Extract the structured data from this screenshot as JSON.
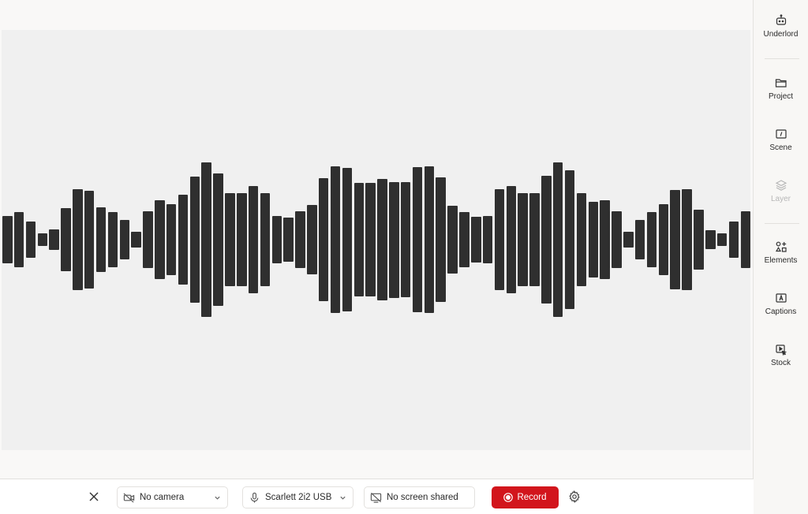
{
  "sidebar": {
    "items": [
      {
        "label": "Underlord",
        "icon": "robot-icon",
        "disabled": false
      },
      {
        "label": "Project",
        "icon": "folder-icon",
        "disabled": false
      },
      {
        "label": "Scene",
        "icon": "scene-icon",
        "disabled": false
      },
      {
        "label": "Layer",
        "icon": "layers-icon",
        "disabled": true
      },
      {
        "label": "Elements",
        "icon": "elements-icon",
        "disabled": false
      },
      {
        "label": "Captions",
        "icon": "captions-icon",
        "disabled": false
      },
      {
        "label": "Stock",
        "icon": "stock-icon",
        "disabled": false
      }
    ]
  },
  "waveform": {
    "icon": "audio-waveform",
    "bar_color": "#2f2f2f",
    "levels": [
      0.31,
      0.36,
      0.23,
      0.08,
      0.13,
      0.41,
      0.65,
      0.63,
      0.42,
      0.36,
      0.26,
      0.1,
      0.37,
      0.51,
      0.46,
      0.58,
      0.82,
      1.0,
      0.86,
      0.6,
      0.6,
      0.69,
      0.6,
      0.31,
      0.29,
      0.37,
      0.45,
      0.8,
      0.95,
      0.93,
      0.73,
      0.73,
      0.79,
      0.75,
      0.74,
      0.94,
      0.95,
      0.81,
      0.44,
      0.36,
      0.3,
      0.31,
      0.65,
      0.69,
      0.6,
      0.6,
      0.83,
      1.0,
      0.9,
      0.6,
      0.49,
      0.51,
      0.37,
      0.1,
      0.26,
      0.36,
      0.46,
      0.64,
      0.65,
      0.39,
      0.12,
      0.08,
      0.23,
      0.37
    ]
  },
  "bottombar": {
    "close_icon": "close-icon",
    "camera": {
      "label": "No camera",
      "icon": "camera-off-icon"
    },
    "microphone": {
      "label": "Scarlett 2i2 USB",
      "icon": "microphone-icon"
    },
    "screen": {
      "label": "No screen shared",
      "icon": "screen-off-icon"
    },
    "record": {
      "label": "Record",
      "icon": "record-icon",
      "color": "#d2151c"
    },
    "settings_icon": "gear-icon"
  }
}
